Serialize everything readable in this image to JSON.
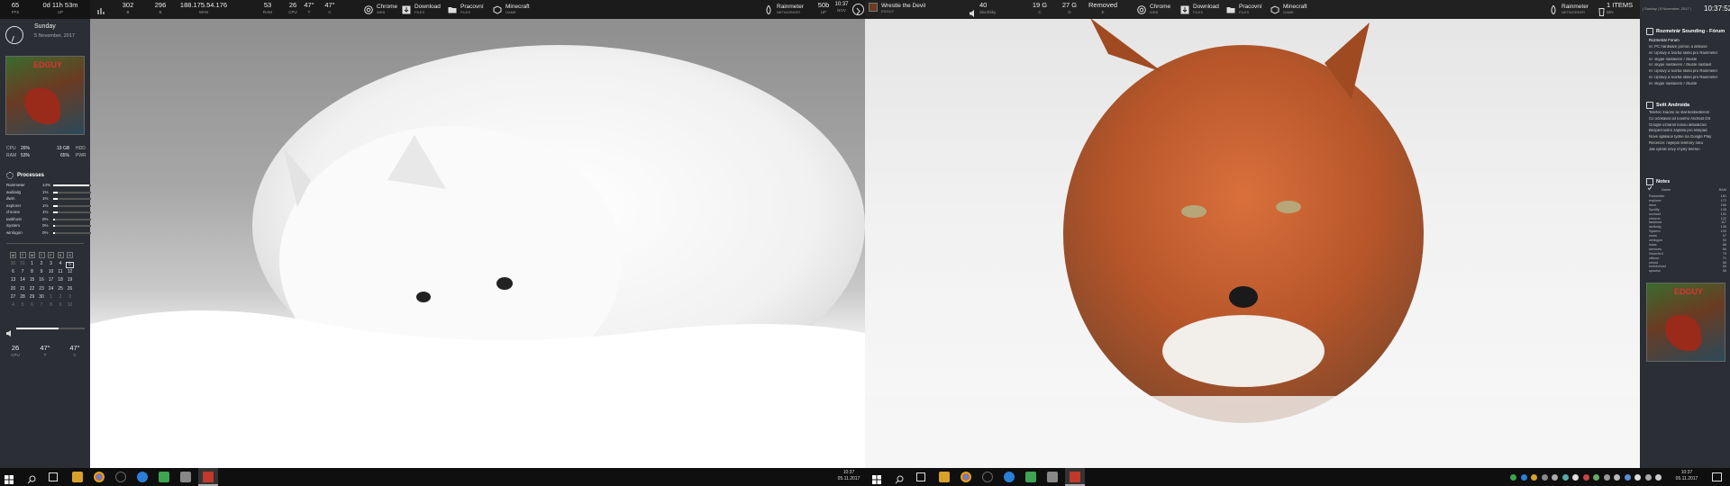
{
  "top_left": {
    "stats": [
      {
        "value": "65",
        "label": "FPS"
      },
      {
        "value": "0d 11h 53m",
        "label": "UP"
      },
      {
        "value": "302",
        "label": "B"
      },
      {
        "value": "296",
        "label": "B"
      },
      {
        "value": "188.175.54.176",
        "label": "WAN"
      },
      {
        "value": "53",
        "label": "RAM"
      },
      {
        "value": "26",
        "label": "CPU"
      },
      {
        "value": "47°",
        "label": "T"
      },
      {
        "value": "47°",
        "label": "C"
      }
    ],
    "launchers": [
      {
        "title": "Chrome",
        "sub": "WEB",
        "icon": "chrome-icon"
      },
      {
        "title": "Download",
        "sub": "FILES",
        "icon": "download-icon"
      },
      {
        "title": "Pracovní",
        "sub": "FILES",
        "icon": "folder-icon"
      },
      {
        "title": "Minecraft",
        "sub": "GAME",
        "icon": "minecraft-icon"
      }
    ],
    "weather": {
      "title": "Rainmeter",
      "sub": "NETWORKER"
    },
    "net": {
      "value": "50b",
      "label": "UP"
    },
    "clock": {
      "value": "10:37",
      "label": "NOV"
    }
  },
  "top_right": {
    "now_playing": {
      "title": "Wrestle the Devil",
      "sub": "EDGUY"
    },
    "volume": {
      "value": "40",
      "label": "Slucháky"
    },
    "disk_c": {
      "value": "19 G",
      "label": "C"
    },
    "disk_d": {
      "value": "27 G",
      "label": "D"
    },
    "status": {
      "value": "Removed",
      "label": "E"
    },
    "launchers": [
      {
        "title": "Chrome",
        "sub": "WEB",
        "icon": "chrome-icon"
      },
      {
        "title": "Download",
        "sub": "FILES",
        "icon": "download-icon"
      },
      {
        "title": "Pracovní",
        "sub": "FILES",
        "icon": "folder-icon"
      },
      {
        "title": "Minecraft",
        "sub": "GAME",
        "icon": "minecraft-icon"
      }
    ],
    "weather": {
      "title": "Rainmeter",
      "sub": "NETWORKER"
    },
    "items": {
      "value": "1 ITEMS",
      "label": "BIN"
    },
    "date": "| Sunday | 5 November, 2017 |",
    "time": "10:37:52"
  },
  "left_sidebar": {
    "day": "Sunday",
    "date": "5 November, 2017",
    "cpu": {
      "label": "CPU",
      "value": "26%",
      "gb": "19 GB",
      "gb_label": "HDD"
    },
    "ram": {
      "label": "RAM",
      "value": "53%",
      "fps": "65%",
      "fps_label": "PWR"
    },
    "processes_title": "Processes",
    "processes": [
      {
        "name": "Rainmeter",
        "pct": "14%",
        "level": 0.95
      },
      {
        "name": "audiodg",
        "pct": "1%",
        "level": 0.12
      },
      {
        "name": "dwm",
        "pct": "1%",
        "level": 0.12
      },
      {
        "name": "explorer",
        "pct": "1%",
        "level": 0.12
      },
      {
        "name": "chrome",
        "pct": "1%",
        "level": 0.12
      },
      {
        "name": "taskhost",
        "pct": "0%",
        "level": 0.05
      },
      {
        "name": "System",
        "pct": "0%",
        "level": 0.05
      },
      {
        "name": "winlogon",
        "pct": "0%",
        "level": 0.05
      }
    ],
    "calendar": {
      "headers": [
        "M",
        "T",
        "W",
        "T",
        "F",
        "S",
        "S"
      ],
      "rows": [
        [
          "30",
          "31",
          "1",
          "2",
          "3",
          "4",
          "5"
        ],
        [
          "6",
          "7",
          "8",
          "9",
          "10",
          "11",
          "12"
        ],
        [
          "13",
          "14",
          "15",
          "16",
          "17",
          "18",
          "19"
        ],
        [
          "20",
          "21",
          "22",
          "23",
          "24",
          "25",
          "26"
        ],
        [
          "27",
          "28",
          "29",
          "30",
          "1",
          "2",
          "3"
        ],
        [
          "4",
          "5",
          "6",
          "7",
          "8",
          "9",
          "10"
        ]
      ]
    },
    "volume_level": 0.62,
    "temps": [
      {
        "value": "26",
        "label": "CPU"
      },
      {
        "value": "47°",
        "label": "T"
      },
      {
        "value": "47°",
        "label": "C"
      }
    ]
  },
  "right_sidebar": {
    "forum_title": "Rozmetrár Sounding - Fórum",
    "forum_sub": "Rozmetrár Fórum",
    "forum_lines": [
      "re: PC hardware pomoc a diskuse",
      "re: Úpravy a tvorba skinů pro Rainmeter",
      "re: skype nastavení / zkuste",
      "re: skype nastavení / zkuste nastavit",
      "re: Úpravy a tvorba skinů pro Rainmeter",
      "re: Úpravy a tvorba skinů pro Rainmeter",
      "re: skype nastavení / zkuste"
    ],
    "android_title": "Svět Androida",
    "android_lines": [
      "Telefon Xiaomi se stal bestsellerem",
      "Co očekávat od nového Android OS",
      "Google oznámil novou aktualizaci",
      "Bezpečnostní záplata pro listopad",
      "Nové aplikace týdne na Google Play",
      "Recenze: nejlepší telefony roku",
      "Jak vybrat nový chytrý telefon"
    ],
    "notes_title": "Notes",
    "ram_header": {
      "name": "Name",
      "ram": "RAM"
    },
    "ram_rows": [
      {
        "name": "Rainmeter",
        "ram": "181"
      },
      {
        "name": "explorer",
        "ram": "172"
      },
      {
        "name": "dwm",
        "ram": "166"
      },
      {
        "name": "Spotify",
        "ram": "145"
      },
      {
        "name": "svchost",
        "ram": "131"
      },
      {
        "name": "chrome",
        "ram": "122"
      },
      {
        "name": "taskhost",
        "ram": "117"
      },
      {
        "name": "audiodg",
        "ram": "108"
      },
      {
        "name": "System",
        "ram": "103"
      },
      {
        "name": "csrss",
        "ram": "97"
      },
      {
        "name": "winlogon",
        "ram": "92"
      },
      {
        "name": "lsass",
        "ram": "88"
      },
      {
        "name": "services",
        "ram": "84"
      },
      {
        "name": "SearchUI",
        "ram": "79"
      },
      {
        "name": "ctfmon",
        "ram": "71"
      },
      {
        "name": "sihost",
        "ram": "66"
      },
      {
        "name": "fontdrvhost",
        "ram": "60"
      },
      {
        "name": "spoolsv",
        "ram": "55"
      }
    ]
  },
  "taskbar": {
    "clock_left": {
      "time": "10:37",
      "date": "05.11.2017"
    },
    "clock_right": {
      "time": "10:37",
      "date": "05.11.2017"
    }
  },
  "colors": {
    "accent": "#ffffff",
    "sidebar": "#2b2e34",
    "bar": "#121212"
  }
}
